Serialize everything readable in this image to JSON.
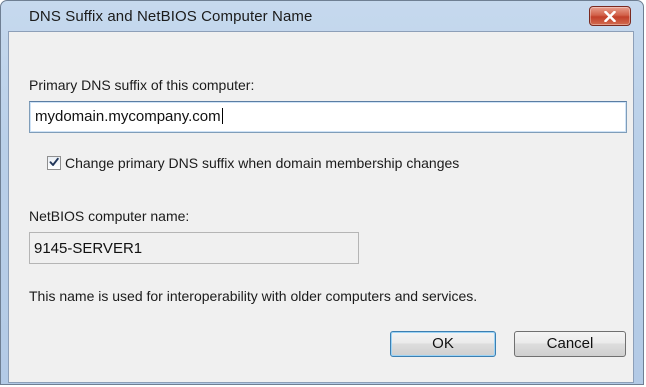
{
  "window": {
    "title": "DNS Suffix and NetBIOS Computer Name"
  },
  "dns": {
    "label": "Primary DNS suffix of this computer:",
    "value": "mydomain.mycompany.com",
    "checkbox_checked": true,
    "checkbox_label": "Change primary DNS suffix when domain membership changes"
  },
  "netbios": {
    "label": "NetBIOS computer name:",
    "value": "9145-SERVER1",
    "note": "This name is used for interoperability with older computers and services."
  },
  "buttons": {
    "ok_label": "OK",
    "cancel_label": "Cancel"
  },
  "icons": {
    "close": "close-icon",
    "check": "checkmark-icon"
  },
  "colors": {
    "titlebar": "#b9cfe8",
    "close_button": "#c2402a",
    "dialog_background": "#f0f0f0",
    "input_border": "#7f9db9"
  }
}
